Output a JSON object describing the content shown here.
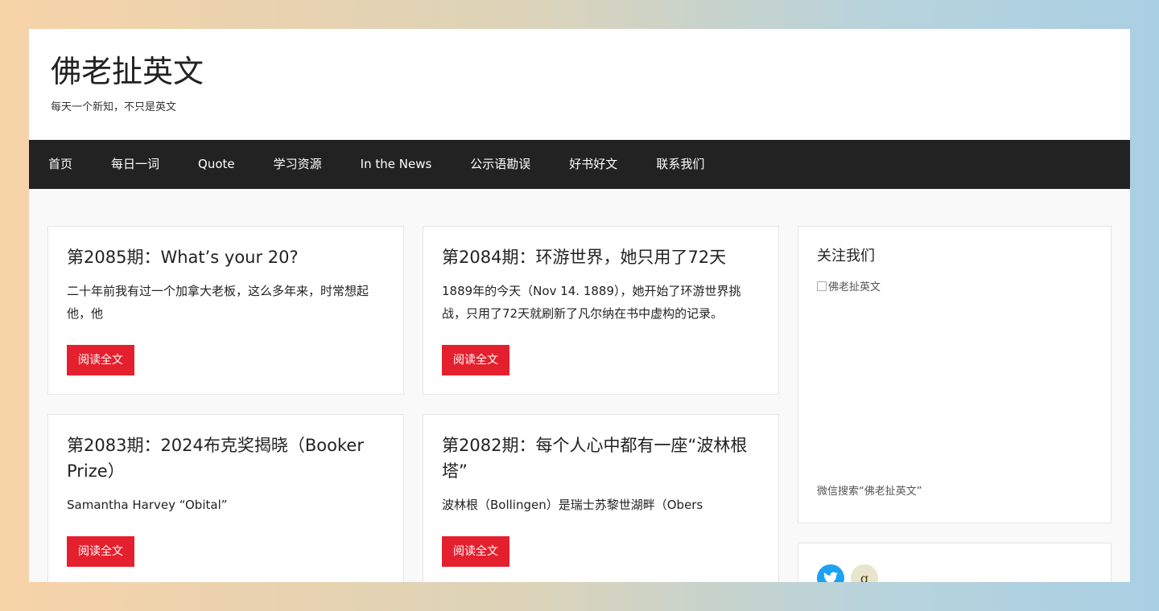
{
  "site": {
    "title": "佛老扯英文",
    "description": "每天一个新知，不只是英文"
  },
  "nav": [
    {
      "label": "首页"
    },
    {
      "label": "每日一词"
    },
    {
      "label": "Quote"
    },
    {
      "label": "学习资源"
    },
    {
      "label": "In the News"
    },
    {
      "label": "公示语勘误"
    },
    {
      "label": "好书好文"
    },
    {
      "label": "联系我们"
    }
  ],
  "posts": [
    {
      "title": "第2085期：What’s your 20?",
      "excerpt": "二十年前我有过一个加拿大老板，这么多年来，时常想起他，他",
      "read_more": "阅读全文"
    },
    {
      "title": "第2084期：环游世界，她只用了72天",
      "excerpt": "1889年的今天（Nov 14. 1889），她开始了环游世界挑战，只用了72天就刷新了凡尔纳在书中虚构的记录。",
      "read_more": "阅读全文"
    },
    {
      "title": "第2083期：2024布克奖揭晓（Booker Prize）",
      "excerpt": "Samantha Harvey “Obital”",
      "read_more": "阅读全文"
    },
    {
      "title": "第2082期：每个人心中都有一座“波林根塔”",
      "excerpt": "波林根（Bollingen）是瑞士苏黎世湖畔（Obers",
      "read_more": "阅读全文"
    }
  ],
  "sidebar": {
    "follow_title": "关注我们",
    "qr_alt": "佛老扯英文",
    "wechat_note": "微信搜索“佛老扯英文”",
    "social": [
      {
        "icon": "twitter-icon",
        "color": "#1da1f2",
        "glyph": "🐦"
      },
      {
        "icon": "goodreads-icon",
        "color": "#e9e5cd",
        "glyph": "g"
      }
    ]
  },
  "colors": {
    "accent": "#e5202e",
    "nav_bg": "#222222"
  }
}
